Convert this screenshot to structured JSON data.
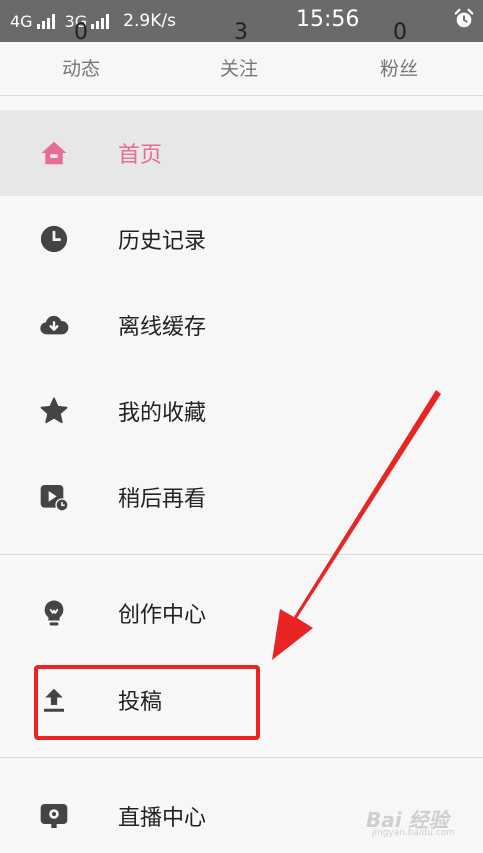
{
  "status_bar": {
    "network_1": "4G",
    "network_2": "3G",
    "speed": "2.9K/s",
    "time": "15:56",
    "alarm_icon": "alarm-clock-icon"
  },
  "stats": [
    {
      "count": "0",
      "label": "动态"
    },
    {
      "count": "3",
      "label": "关注"
    },
    {
      "count": "0",
      "label": "粉丝"
    }
  ],
  "menu": {
    "items": [
      {
        "label": "首页",
        "icon": "home-icon",
        "active": true
      },
      {
        "label": "历史记录",
        "icon": "clock-icon"
      },
      {
        "label": "离线缓存",
        "icon": "cloud-download-icon"
      },
      {
        "label": "我的收藏",
        "icon": "star-icon"
      },
      {
        "label": "稍后再看",
        "icon": "watch-later-icon"
      },
      {
        "label": "创作中心",
        "icon": "lightbulb-icon"
      },
      {
        "label": "投稿",
        "icon": "upload-icon"
      },
      {
        "label": "直播中心",
        "icon": "live-tv-icon"
      }
    ]
  },
  "colors": {
    "accent_pink": "#e96c94",
    "icon_gray": "#444444",
    "annotation_red": "#e82424"
  },
  "watermark": {
    "main": "Bai 经验",
    "sub": "jingyan.baidu.com"
  }
}
